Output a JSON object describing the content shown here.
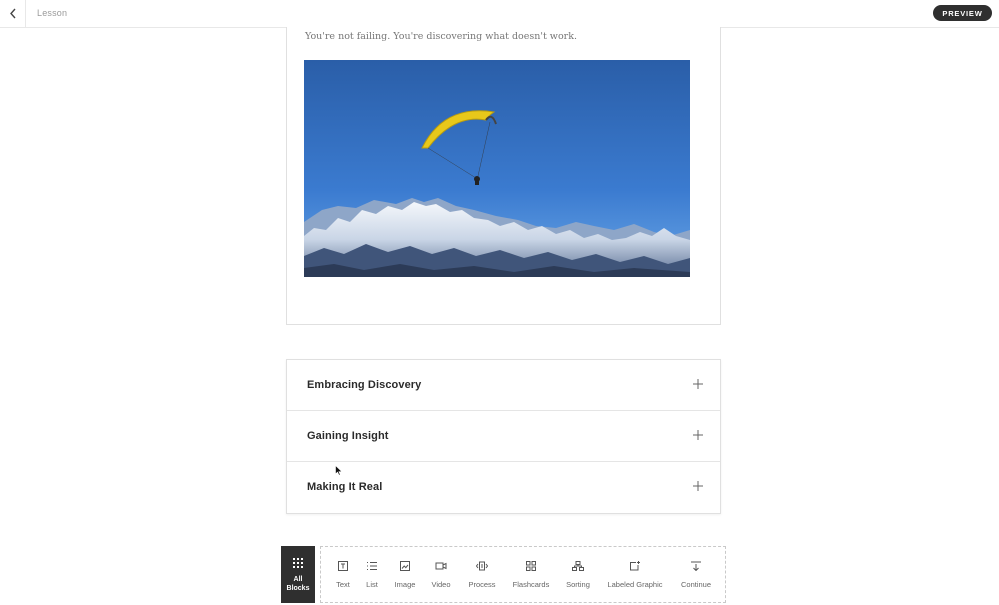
{
  "topbar": {
    "title": "Lesson",
    "preview_label": "PREVIEW"
  },
  "image_card": {
    "intro_text": "You're not failing. You're discovering what doesn't work."
  },
  "accordion": {
    "items": [
      {
        "title": "Embracing Discovery"
      },
      {
        "title": "Gaining Insight"
      },
      {
        "title": "Making It Real"
      }
    ]
  },
  "block_toolbar": {
    "all_blocks_label": "All\nBlocks",
    "blocks": [
      {
        "label": "Text",
        "icon": "text-icon"
      },
      {
        "label": "List",
        "icon": "list-icon"
      },
      {
        "label": "Image",
        "icon": "image-icon"
      },
      {
        "label": "Video",
        "icon": "video-icon"
      },
      {
        "label": "Process",
        "icon": "process-icon"
      },
      {
        "label": "Flashcards",
        "icon": "flashcards-icon"
      },
      {
        "label": "Sorting",
        "icon": "sorting-icon"
      },
      {
        "label": "Labeled Graphic",
        "icon": "labeled-graphic-icon"
      },
      {
        "label": "Continue",
        "icon": "continue-icon"
      }
    ]
  },
  "colors": {
    "dark_button": "#2f2f2f",
    "sky_blue": "#2f66b0",
    "paraglider_yellow": "#e8c81a"
  }
}
